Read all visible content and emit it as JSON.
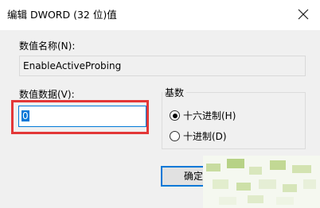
{
  "window": {
    "title": "编辑 DWORD (32 位)值"
  },
  "name_section": {
    "label": "数值名称(N):",
    "value": "EnableActiveProbing"
  },
  "data_section": {
    "label": "数值数据(V):",
    "value": "0"
  },
  "base_section": {
    "label": "基数",
    "options": [
      {
        "label": "十六进制(H)",
        "selected": true
      },
      {
        "label": "十进制(D)",
        "selected": false
      }
    ]
  },
  "buttons": {
    "ok_label": "确定"
  },
  "colors": {
    "accent": "#0078d7",
    "highlight": "#e33737",
    "dialog_bg": "#f0f0f0"
  },
  "icons": {
    "close": "close-icon"
  }
}
